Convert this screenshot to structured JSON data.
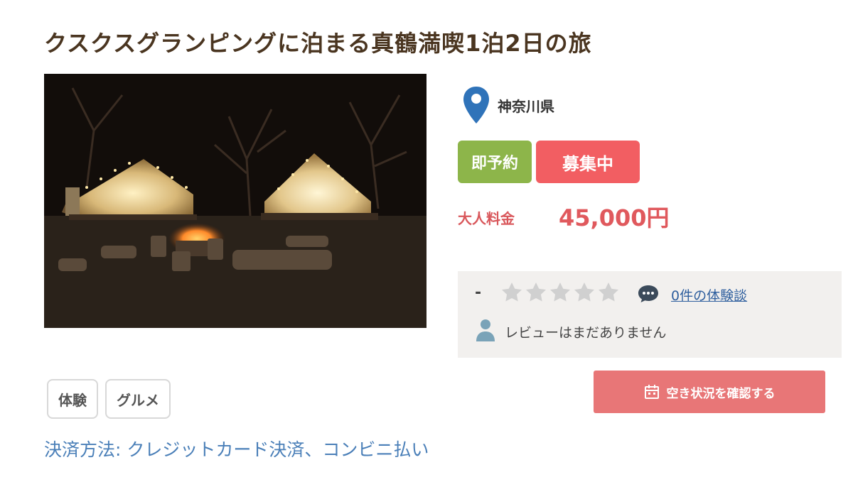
{
  "title": "クスクスグランピングに泊まる真鶴満喫1泊2日の旅",
  "photo": {
    "description_icon": "photo-glamping-tents-night"
  },
  "location": {
    "icon": "map-pin-icon",
    "prefecture": "神奈川県"
  },
  "badges": {
    "instant": "即予約",
    "status": "募集中"
  },
  "price": {
    "label": "大人料金",
    "value": "45,000円"
  },
  "review": {
    "score": "-",
    "stars_filled": 0,
    "stars_total": 5,
    "count_link": "0件の体験談",
    "empty_message": "レビューはまだありません"
  },
  "availability_button": {
    "label": "空き状況を確認する",
    "icon": "calendar-icon"
  },
  "tags": [
    "体験",
    "グルメ"
  ],
  "payment": "決済方法: クレジットカード決済、コンビニ払い",
  "colors": {
    "title": "#4a3520",
    "instant_badge": "#8db54a",
    "status_badge": "#f25e62",
    "price": "#e0595d",
    "button": "#e87677",
    "link": "#2f5f9e",
    "pin": "#2f73b9"
  }
}
